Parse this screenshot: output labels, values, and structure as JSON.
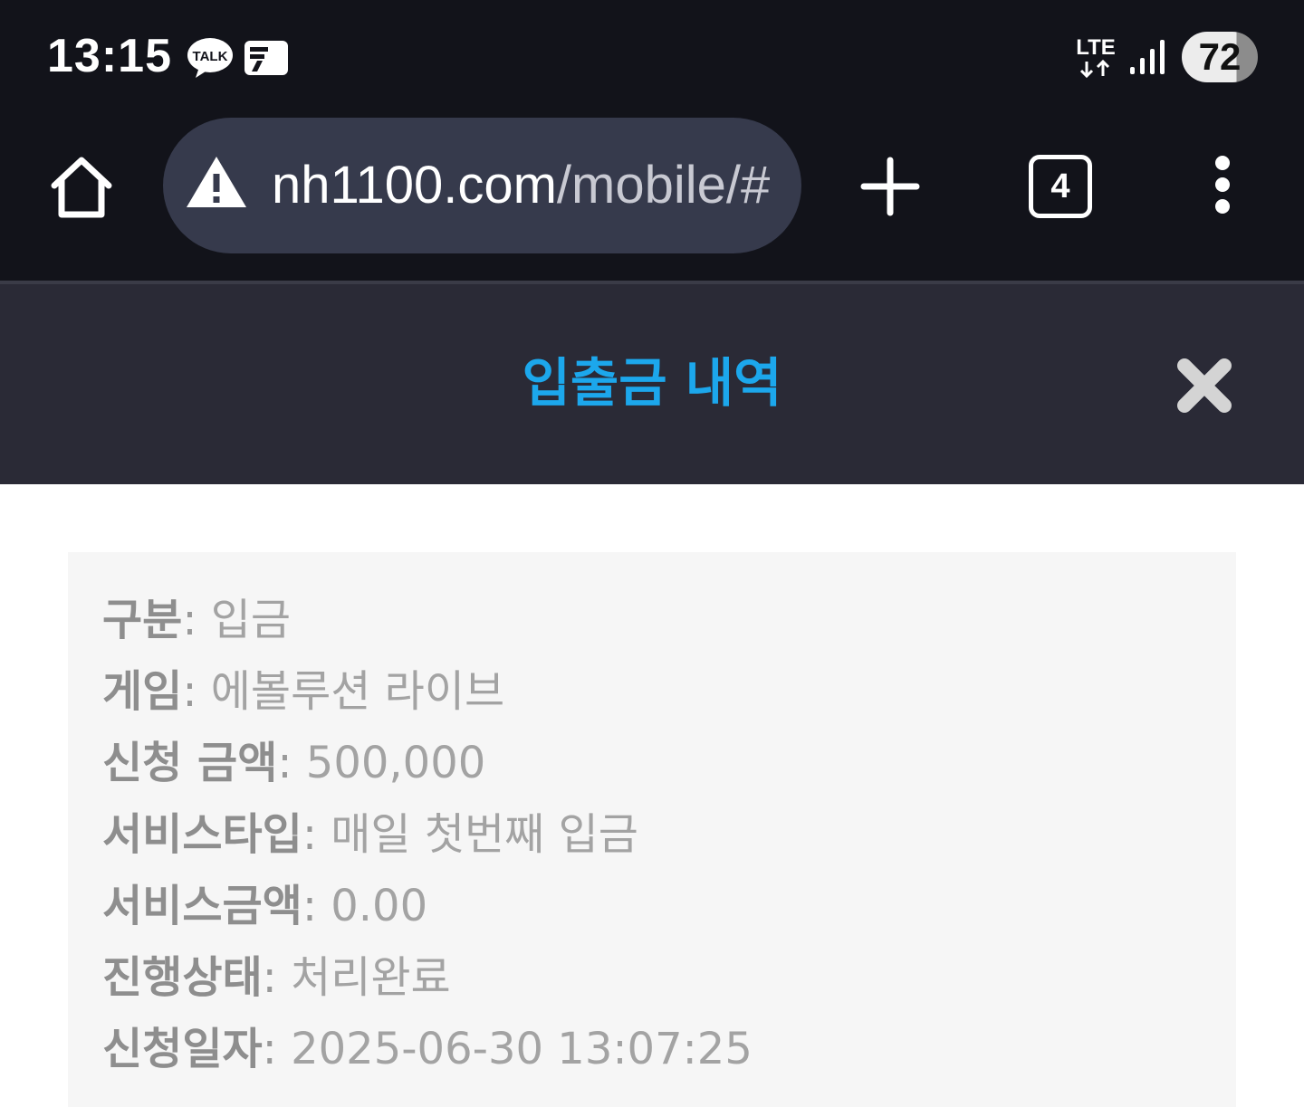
{
  "status_bar": {
    "time": "13:15",
    "icons": [
      "kakaotalk-icon",
      "news-icon",
      "lte-icon",
      "signal-icon"
    ],
    "network": "LTE",
    "battery_level": "72"
  },
  "browser": {
    "url_host": "nh1100.com",
    "url_path": "/mobile/#",
    "tab_count": "4",
    "icons": [
      "home-icon",
      "warning-icon",
      "plus-icon",
      "more-vert-icon"
    ]
  },
  "modal": {
    "title": "입출금 내역",
    "close_icon": "close-x-icon"
  },
  "details": [
    {
      "label": "구분",
      "value": "입금"
    },
    {
      "label": "게임",
      "value": "에볼루션 라이브"
    },
    {
      "label": "신청 금액",
      "value": "500,000"
    },
    {
      "label": "서비스타입",
      "value": "매일 첫번째 입금"
    },
    {
      "label": "서비스금액",
      "value": "0.00"
    },
    {
      "label": "진행상태",
      "value": "처리완료"
    },
    {
      "label": "신청일자",
      "value": "2025-06-30 13:07:25"
    }
  ],
  "colors": {
    "status_bg": "#12131a",
    "url_bar_bg": "#363a4c",
    "modal_header_bg": "#2a2a36",
    "title_accent": "#1ca7ec",
    "card_bg": "#f6f6f6",
    "text_gray": "#9a9a9a"
  }
}
